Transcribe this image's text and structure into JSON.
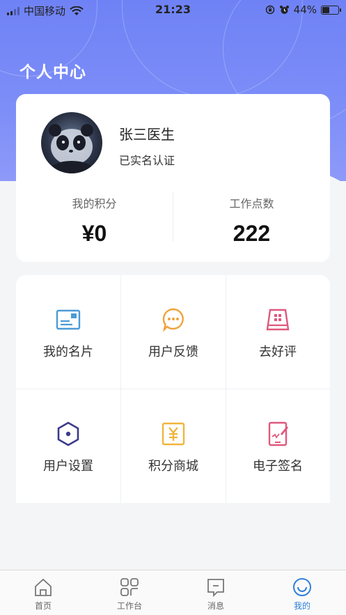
{
  "status_bar": {
    "carrier": "中国移动",
    "time": "21:23",
    "battery_percent": "44%",
    "battery_level": 0.44
  },
  "page": {
    "title": "个人中心"
  },
  "profile": {
    "name": "张三医生",
    "status": "已实名认证"
  },
  "stats": [
    {
      "label": "我的积分",
      "value": "¥0"
    },
    {
      "label": "工作点数",
      "value": "222"
    }
  ],
  "menu": [
    {
      "label": "我的名片",
      "icon": "business-card-icon",
      "color": "#4a9bd6"
    },
    {
      "label": "用户反馈",
      "icon": "chat-bubble-icon",
      "color": "#f0a33c"
    },
    {
      "label": "去好评",
      "icon": "rating-store-icon",
      "color": "#e0577d"
    },
    {
      "label": "用户设置",
      "icon": "hexagon-settings-icon",
      "color": "#3d3a8c"
    },
    {
      "label": "积分商城",
      "icon": "yen-mall-icon",
      "color": "#f0b53c"
    },
    {
      "label": "电子签名",
      "icon": "tablet-signature-icon",
      "color": "#e0577d"
    }
  ],
  "tabs": [
    {
      "label": "首页",
      "icon": "home-icon",
      "active": false
    },
    {
      "label": "工作台",
      "icon": "workbench-grid-icon",
      "active": false
    },
    {
      "label": "消息",
      "icon": "message-icon",
      "active": false
    },
    {
      "label": "我的",
      "icon": "profile-smile-icon",
      "active": true
    }
  ],
  "colors": {
    "header_gradient_top": "#6f82f5",
    "active_tab": "#2f7fd9",
    "background": "#f4f5f7"
  }
}
